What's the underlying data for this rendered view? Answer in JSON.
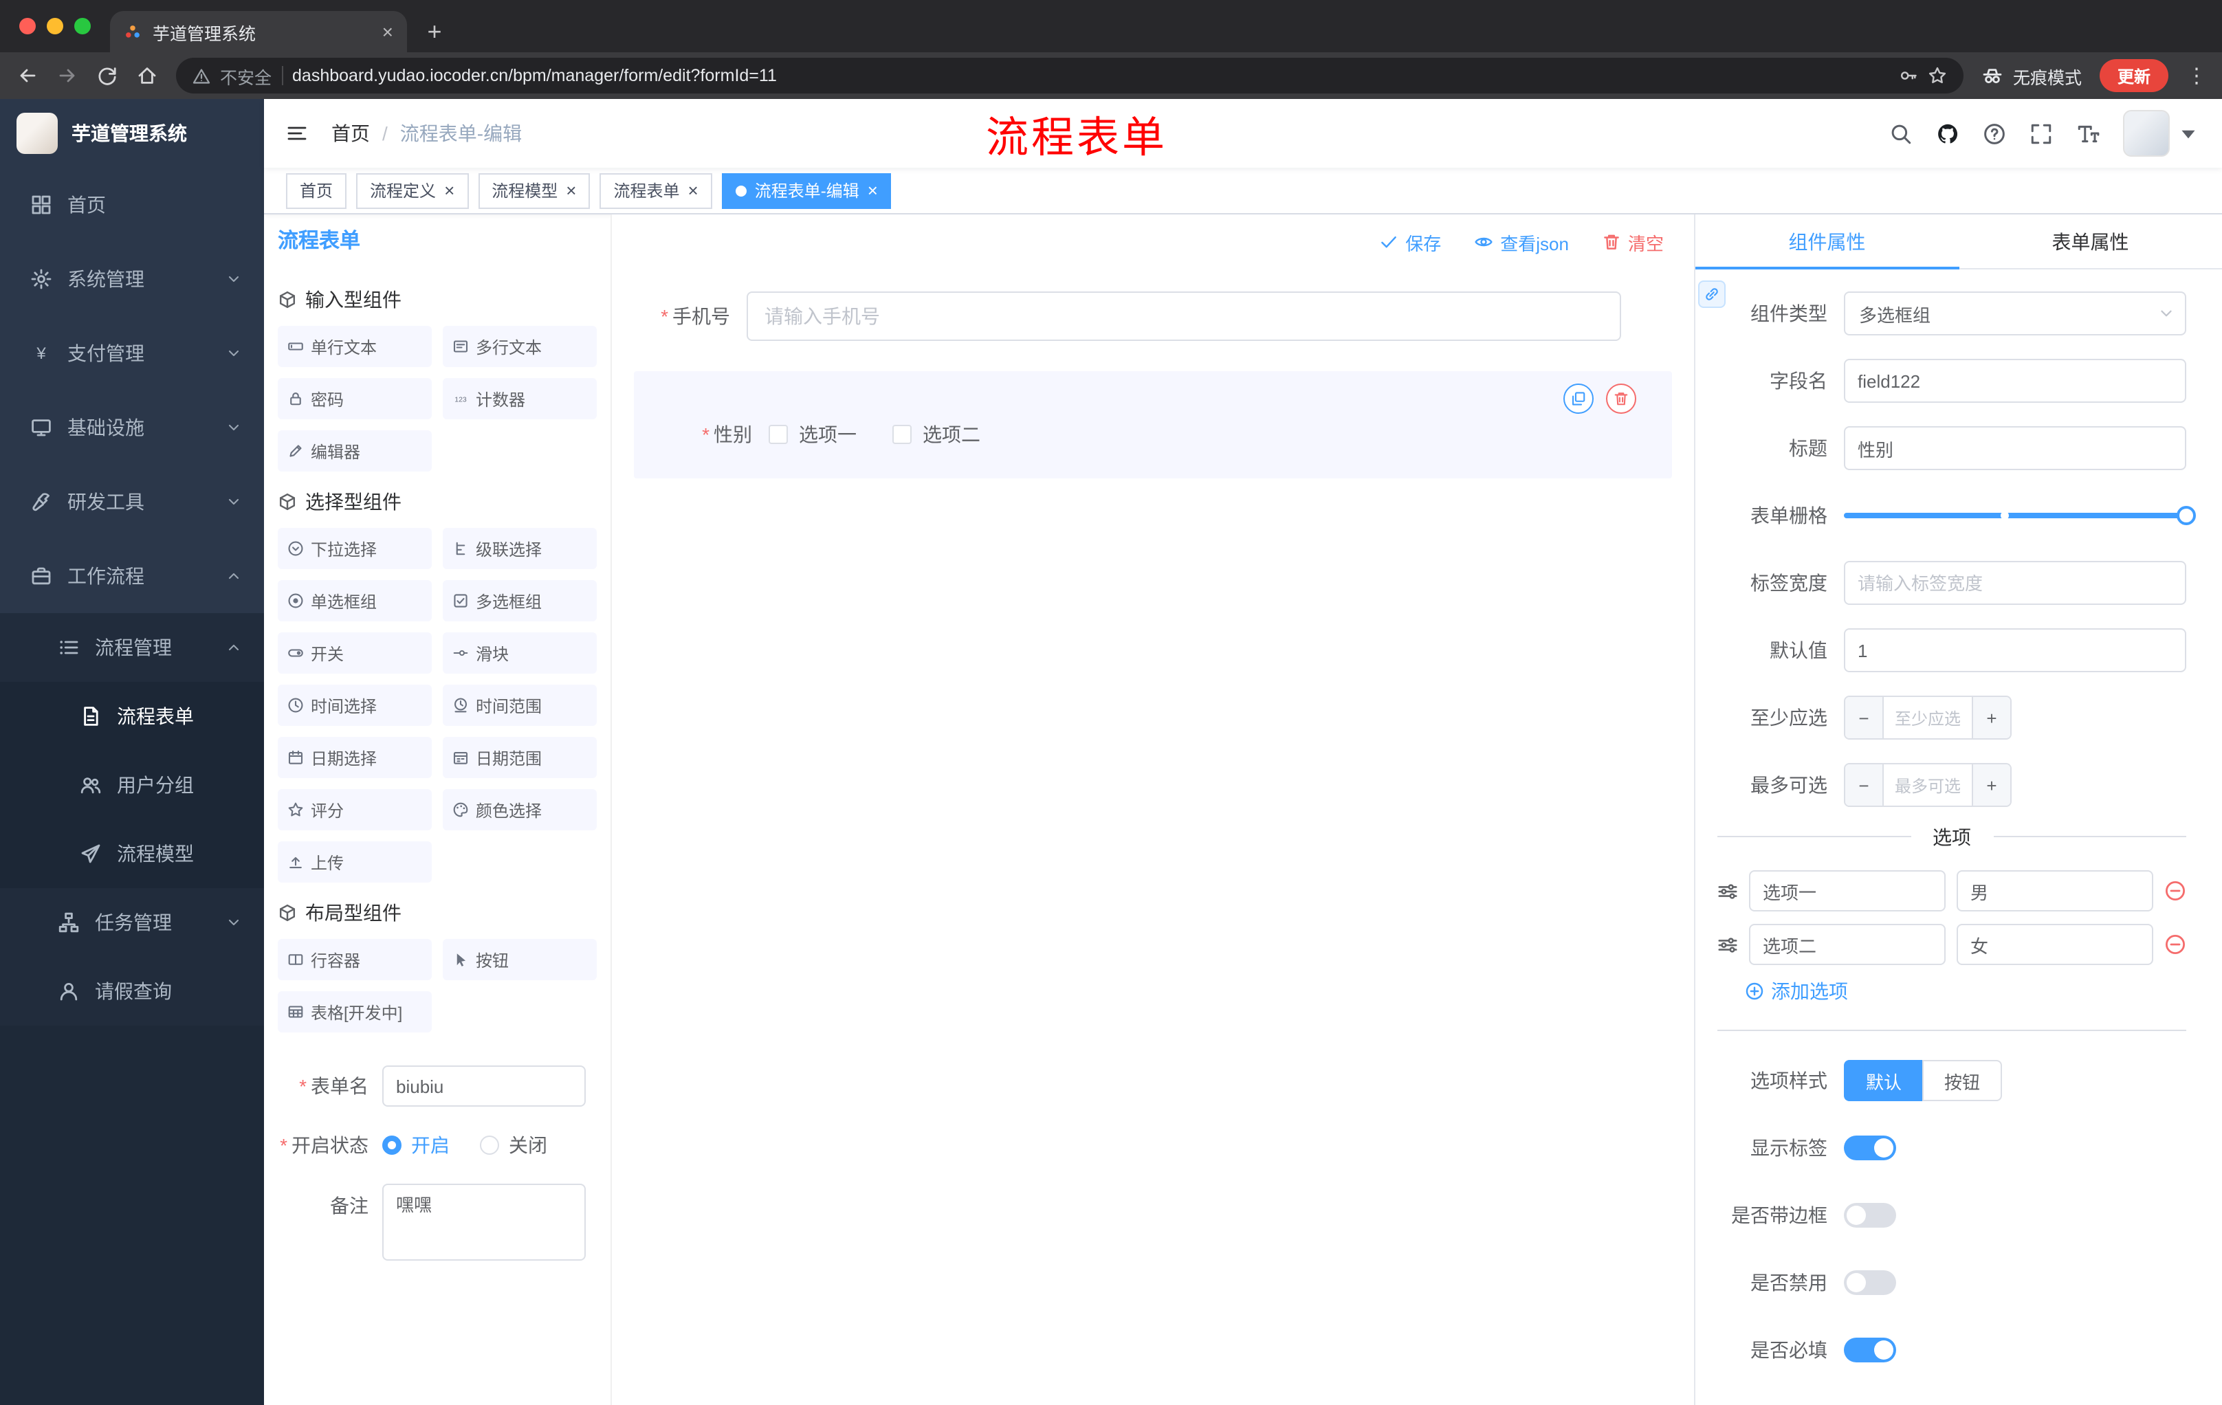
{
  "colors": {
    "accent": "#409eff",
    "danger": "#f56c6c",
    "annotation_red": "#ff0000",
    "update_button": "#e8453c",
    "sidebar_bg": "#2b374a"
  },
  "browser": {
    "tab_title": "芋道管理系统",
    "security_label": "不安全",
    "url": "dashboard.yudao.iocoder.cn/bpm/manager/form/edit?formId=11",
    "incognito_label": "无痕模式",
    "update_label": "更新"
  },
  "sidebar": {
    "logo_title": "芋道管理系统",
    "menu": [
      {
        "label": "首页"
      },
      {
        "label": "系统管理"
      },
      {
        "label": "支付管理"
      },
      {
        "label": "基础设施"
      },
      {
        "label": "研发工具"
      },
      {
        "label": "工作流程"
      }
    ],
    "submenu": [
      {
        "label": "流程管理"
      },
      {
        "label": "流程表单"
      },
      {
        "label": "用户分组"
      },
      {
        "label": "流程模型"
      },
      {
        "label": "任务管理"
      },
      {
        "label": "请假查询"
      }
    ]
  },
  "header": {
    "breadcrumb_home": "首页",
    "breadcrumb_current": "流程表单-编辑",
    "annotation": "流程表单"
  },
  "tags": {
    "items": [
      {
        "label": "首页"
      },
      {
        "label": "流程定义"
      },
      {
        "label": "流程模型"
      },
      {
        "label": "流程表单"
      },
      {
        "label": "流程表单-编辑"
      }
    ]
  },
  "panel_left": {
    "title": "流程表单",
    "sections": [
      {
        "title": "输入型组件",
        "items": [
          "单行文本",
          "多行文本",
          "密码",
          "计数器",
          "编辑器"
        ]
      },
      {
        "title": "选择型组件",
        "items": [
          "下拉选择",
          "级联选择",
          "单选框组",
          "多选框组",
          "开关",
          "滑块",
          "时间选择",
          "时间范围",
          "日期选择",
          "日期范围",
          "评分",
          "颜色选择",
          "上传"
        ]
      },
      {
        "title": "布局型组件",
        "items": [
          "行容器",
          "按钮",
          "表格[开发中]"
        ]
      }
    ],
    "form": {
      "name_label": "表单名",
      "name_value": "biubiu",
      "status_label": "开启状态",
      "status_on": "开启",
      "status_off": "关闭",
      "remark_label": "备注",
      "remark_value": "嘿嘿"
    }
  },
  "canvas": {
    "toolbar": {
      "save": "保存",
      "view_json": "查看json",
      "clear": "清空"
    },
    "phone_field": {
      "label": "手机号",
      "placeholder": "请输入手机号"
    },
    "gender_field": {
      "label": "性别",
      "option1": "选项一",
      "option2": "选项二"
    }
  },
  "panel_right": {
    "tab_component": "组件属性",
    "tab_form": "表单属性",
    "component_type": {
      "label": "组件类型",
      "value": "多选框组"
    },
    "field_name": {
      "label": "字段名",
      "value": "field122"
    },
    "title_row": {
      "label": "标题",
      "value": "性别"
    },
    "grid_row": {
      "label": "表单栅格"
    },
    "label_width": {
      "label": "标签宽度",
      "placeholder": "请输入标签宽度"
    },
    "default_value": {
      "label": "默认值",
      "value": "1"
    },
    "min_select": {
      "label": "至少应选",
      "placeholder": "至少应选"
    },
    "max_select": {
      "label": "最多可选",
      "placeholder": "最多可选"
    },
    "options_title": "选项",
    "options": [
      {
        "text": "选项一",
        "value": "男"
      },
      {
        "text": "选项二",
        "value": "女"
      }
    ],
    "add_option": "添加选项",
    "option_style": {
      "label": "选项样式",
      "default": "默认",
      "button": "按钮"
    },
    "toggles": [
      {
        "label": "显示标签",
        "on": true
      },
      {
        "label": "是否带边框",
        "on": false
      },
      {
        "label": "是否禁用",
        "on": false
      },
      {
        "label": "是否必填",
        "on": true
      }
    ]
  }
}
